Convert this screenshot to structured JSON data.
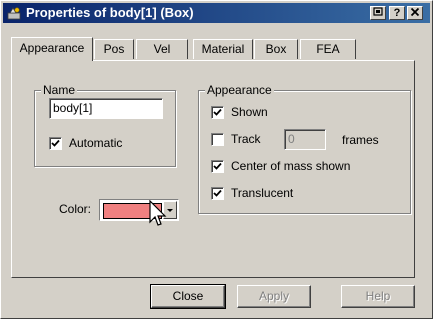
{
  "window": {
    "title": "Properties of body[1] (Box)",
    "title_buttons": [
      "restore",
      "?",
      "x"
    ]
  },
  "tabs": [
    {
      "label": "Appearance",
      "active": true
    },
    {
      "label": "Pos",
      "active": false
    },
    {
      "label": "Vel",
      "active": false
    },
    {
      "label": "Material",
      "active": false
    },
    {
      "label": "Box",
      "active": false
    },
    {
      "label": "FEA",
      "active": false
    }
  ],
  "name_group": {
    "legend": "Name",
    "value": "body[1]",
    "automatic_label": "Automatic",
    "automatic_checked": true
  },
  "color": {
    "label": "Color:",
    "swatch_hex": "#f08080"
  },
  "appearance_group": {
    "legend": "Appearance",
    "shown_label": "Shown",
    "shown_checked": true,
    "track_label": "Track",
    "track_checked": false,
    "track_frames_value": "0",
    "frames_label": "frames",
    "com_label": "Center of mass shown",
    "com_checked": true,
    "translucent_label": "Translucent",
    "translucent_checked": true
  },
  "buttons": {
    "close": "Close",
    "apply": "Apply",
    "help": "Help"
  },
  "colors": {
    "titlebar_start": "#0a246a",
    "titlebar_end": "#3a6ea5",
    "face": "#d4d0c8"
  }
}
